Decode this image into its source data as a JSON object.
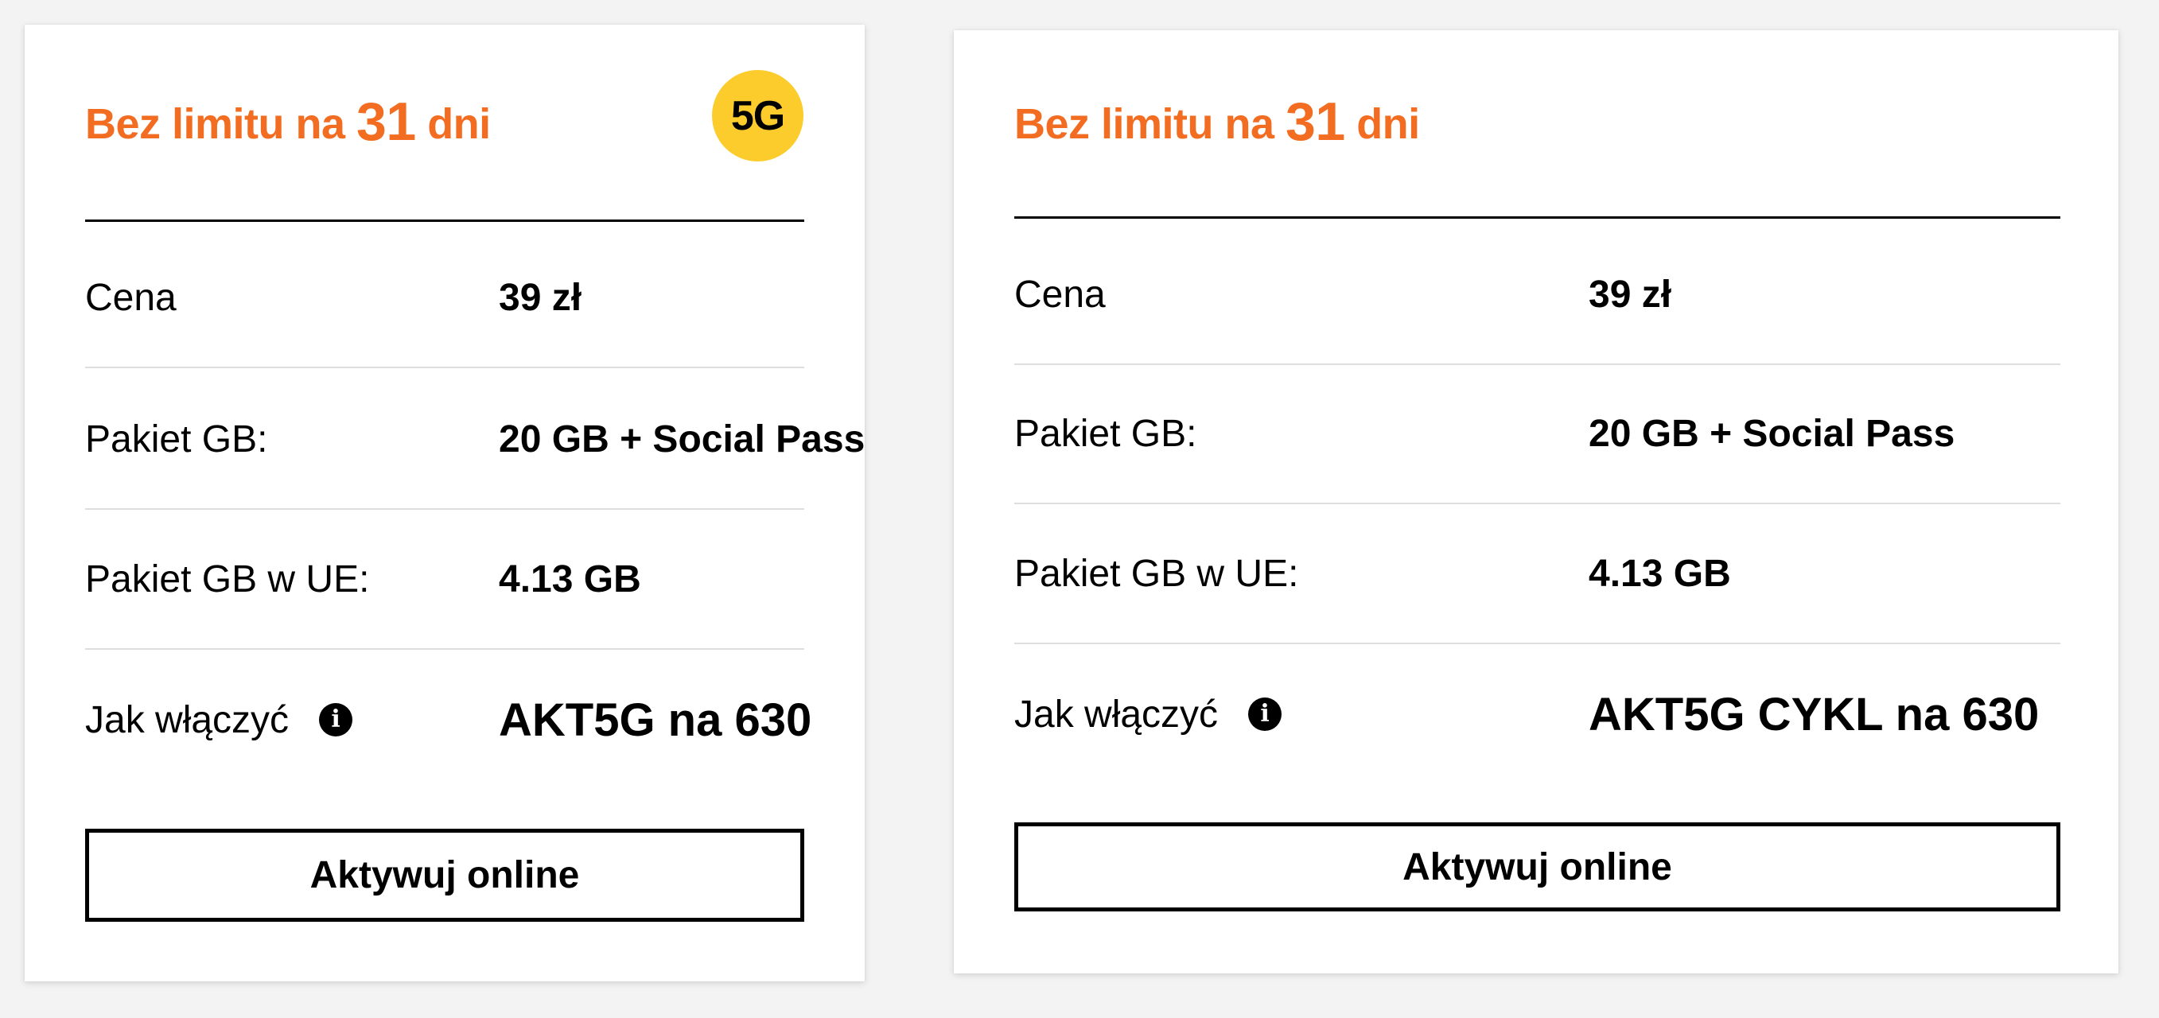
{
  "cards": [
    {
      "title_prefix": "Bez limitu na ",
      "title_number": "31",
      "title_suffix": " dni",
      "badge": "5G",
      "rows": [
        {
          "label": "Cena",
          "value": "39 zł"
        },
        {
          "label": "Pakiet GB:",
          "value": "20 GB + Social Pass"
        },
        {
          "label": "Pakiet GB w UE:",
          "value": "4.13 GB"
        },
        {
          "label": "Jak włączyć",
          "value": "AKT5G na 630"
        }
      ],
      "button_label": "Aktywuj online"
    },
    {
      "title_prefix": "Bez limitu na ",
      "title_number": "31",
      "title_suffix": " dni",
      "rows": [
        {
          "label": "Cena",
          "value": "39 zł"
        },
        {
          "label": "Pakiet GB:",
          "value": "20 GB + Social Pass"
        },
        {
          "label": "Pakiet GB w UE:",
          "value": "4.13 GB"
        },
        {
          "label": "Jak włączyć",
          "value": "AKT5G CYKL na 630"
        }
      ],
      "button_label": "Aktywuj online"
    }
  ],
  "colors": {
    "accent_orange": "#f26d21",
    "badge_yellow": "#fccc2c",
    "background": "#f3f3f3"
  },
  "icons": {
    "info": "info-icon"
  }
}
